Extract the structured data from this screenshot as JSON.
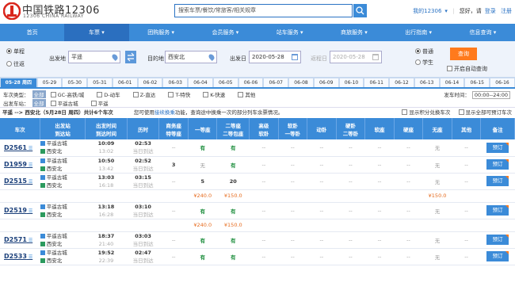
{
  "header": {
    "logo_cn": "中国铁路12306",
    "logo_en": "12306 CHINA RAILWAY",
    "search_placeholder": "搜索车票/餐饮/常旅客/相关规章",
    "my12306": "我的12306",
    "greeting": "您好，请",
    "login": "登录",
    "register": "注册"
  },
  "nav": [
    "首页",
    "车票",
    "团购服务",
    "会员服务",
    "站车服务",
    "商旅服务",
    "出行指南",
    "信息查询"
  ],
  "nav_active": 1,
  "query": {
    "trip_types": [
      "单程",
      "往返"
    ],
    "from_label": "出发地",
    "from_value": "平遥",
    "to_label": "目的地",
    "to_value": "西安北",
    "depart_label": "出发日",
    "depart_value": "2020-05-28",
    "return_label": "返程日",
    "return_value": "2020-05-28",
    "passenger_types": [
      "普通",
      "学生"
    ],
    "search_button": "查询",
    "auto_query": "开启自动查询"
  },
  "dates": [
    "05-28 周四",
    "05-29",
    "05-30",
    "05-31",
    "06-01",
    "06-02",
    "06-03",
    "06-04",
    "06-05",
    "06-06",
    "06-07",
    "06-08",
    "06-09",
    "06-10",
    "06-11",
    "06-12",
    "06-13",
    "06-14",
    "06-15",
    "06-16"
  ],
  "filters": {
    "type_label": "车次类型：",
    "all": "全部",
    "types": [
      "GC-高铁/城",
      "D-动车",
      "Z-直达",
      "T-特快",
      "K-快速",
      "其他"
    ],
    "station_label": "出发车站：",
    "stations": [
      "平遥古城",
      "平遥"
    ],
    "time_label": "发车时间：",
    "time_value": "00:00--24:00"
  },
  "summary": {
    "route": "平遥 --> 西安北（5月28日 周四）共计6个车次",
    "hint_pre": "您可使用",
    "hint_link": "接续换乘",
    "hint_post": "功能，查询途中换乘一次的部分列车余票情况。",
    "opt1": "显示积分兑换车次",
    "opt2": "显示全部可预订车次"
  },
  "table": {
    "headers": [
      "车次",
      "出发站\n到达站",
      "出发时间\n到达时间",
      "历时",
      "商务座\n特等座",
      "一等座",
      "二等座\n二等包座",
      "高级\n软卧",
      "软卧\n一等卧",
      "动卧",
      "硬卧\n二等卧",
      "软座",
      "硬座",
      "无座",
      "其他",
      "备注"
    ],
    "book_label": "预订",
    "rows": [
      {
        "train": "D2561",
        "from": "平遥古城",
        "to": "西安北",
        "dep": "10:09",
        "arr": "13:02",
        "dur": "02:53",
        "day": "当日到达",
        "cells": [
          "--",
          "有",
          "有",
          "--",
          "--",
          "--",
          "--",
          "--",
          "--",
          "无",
          "--"
        ],
        "price": null
      },
      {
        "train": "D1959",
        "from": "平遥古城",
        "to": "西安北",
        "dep": "10:50",
        "arr": "13:42",
        "dur": "02:52",
        "day": "当日到达",
        "cells": [
          "3",
          "无",
          "有",
          "--",
          "--",
          "--",
          "--",
          "--",
          "--",
          "无",
          "--"
        ],
        "price": null
      },
      {
        "train": "D2515",
        "from": "平遥古城",
        "to": "西安北",
        "dep": "13:03",
        "arr": "16:18",
        "dur": "03:15",
        "day": "当日到达",
        "cells": [
          "--",
          "5",
          "20",
          "--",
          "--",
          "--",
          "--",
          "--",
          "--",
          "无",
          "--"
        ],
        "price": [
          "",
          "¥240.0",
          "¥150.0",
          "",
          "",
          "",
          "",
          "",
          "",
          "¥150.0",
          ""
        ]
      },
      {
        "train": "D2519",
        "from": "平遥古城",
        "to": "西安北",
        "dep": "13:18",
        "arr": "16:28",
        "dur": "03:10",
        "day": "当日到达",
        "cells": [
          "--",
          "有",
          "有",
          "--",
          "--",
          "--",
          "--",
          "--",
          "--",
          "无",
          "--"
        ],
        "price": [
          "",
          "¥240.0",
          "¥150.0",
          "",
          "",
          "",
          "",
          "",
          "",
          "",
          ""
        ]
      },
      {
        "train": "D2571",
        "from": "平遥古城",
        "to": "西安北",
        "dep": "18:37",
        "arr": "21:40",
        "dur": "03:03",
        "day": "当日到达",
        "cells": [
          "--",
          "有",
          "有",
          "--",
          "--",
          "--",
          "--",
          "--",
          "--",
          "无",
          "--"
        ],
        "price": null
      },
      {
        "train": "D2533",
        "from": "平遥古城",
        "to": "西安北",
        "dep": "19:52",
        "arr": "22:39",
        "dur": "02:47",
        "day": "当日到达",
        "cells": [
          "--",
          "有",
          "有",
          "--",
          "--",
          "--",
          "--",
          "--",
          "--",
          "无",
          "--"
        ],
        "price": null
      }
    ]
  },
  "colors": {
    "primary": "#3b8bd8",
    "accent": "#ff7a1c",
    "available": "#1e8e3e"
  }
}
